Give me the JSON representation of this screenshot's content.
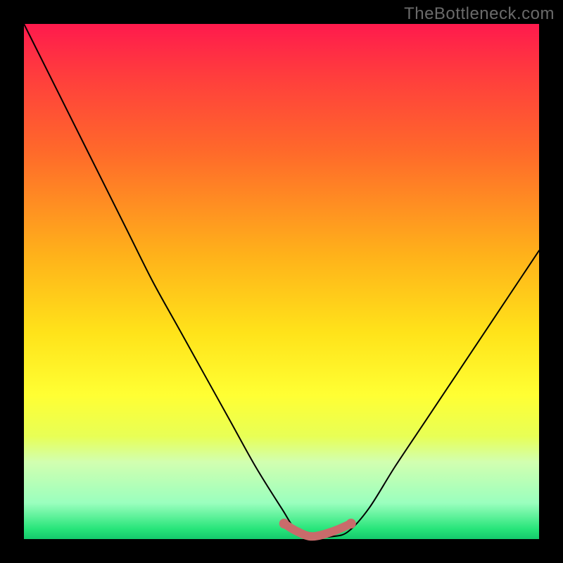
{
  "watermark": "TheBottleneck.com",
  "chart_data": {
    "type": "line",
    "title": "",
    "xlabel": "",
    "ylabel": "",
    "xlim": [
      0,
      1
    ],
    "ylim": [
      0,
      1
    ],
    "series": [
      {
        "name": "curve",
        "x": [
          0.0,
          0.05,
          0.1,
          0.15,
          0.2,
          0.25,
          0.3,
          0.35,
          0.4,
          0.45,
          0.5,
          0.53,
          0.56,
          0.6,
          0.63,
          0.67,
          0.72,
          0.78,
          0.84,
          0.9,
          0.96,
          1.0
        ],
        "values": [
          1.0,
          0.9,
          0.8,
          0.7,
          0.6,
          0.5,
          0.41,
          0.32,
          0.23,
          0.14,
          0.06,
          0.015,
          0.005,
          0.005,
          0.015,
          0.06,
          0.14,
          0.23,
          0.32,
          0.41,
          0.5,
          0.56
        ]
      },
      {
        "name": "highlight-segment",
        "x": [
          0.505,
          0.53,
          0.56,
          0.6,
          0.635
        ],
        "values": [
          0.03,
          0.015,
          0.005,
          0.015,
          0.03
        ]
      }
    ],
    "annotations": [],
    "colors": {
      "curve": "#000000",
      "highlight": "#c96b6b",
      "gradient_top": "#ff1a4d",
      "gradient_bottom": "#14c96c",
      "frame": "#000000"
    }
  }
}
